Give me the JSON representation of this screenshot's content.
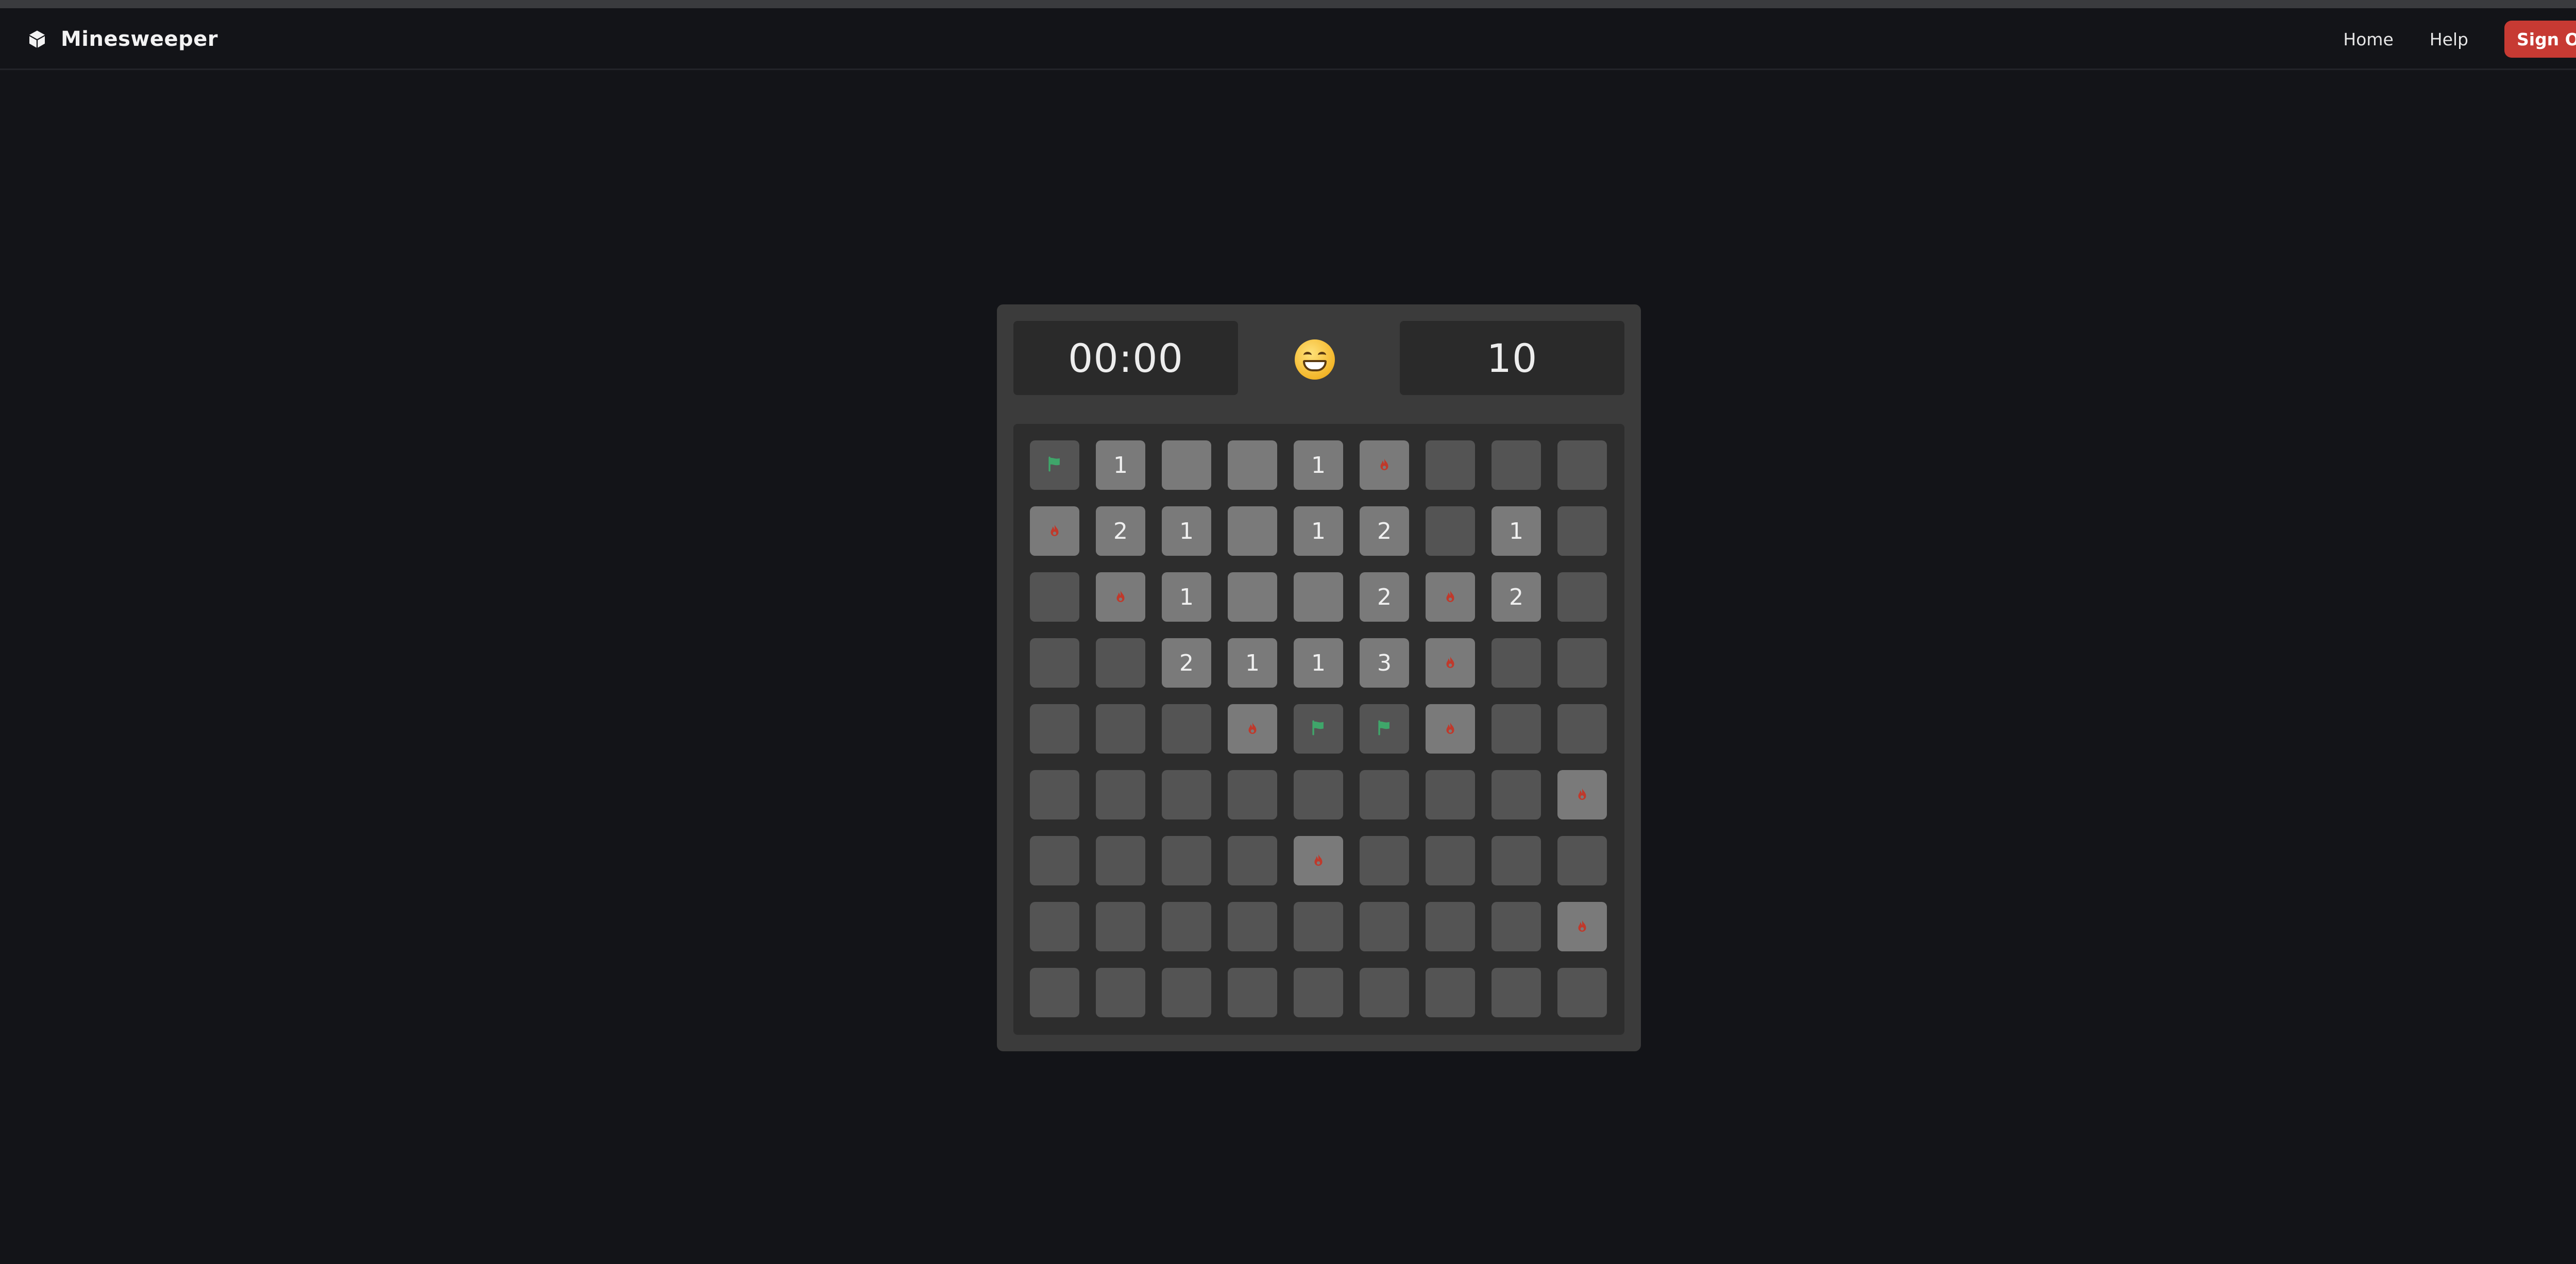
{
  "app": {
    "title": "Minesweeper",
    "brand_icon": "cube-icon"
  },
  "nav": {
    "home_label": "Home",
    "help_label": "Help",
    "signout_label": "Sign Out",
    "signout_color": "#c73a33"
  },
  "game": {
    "timer": "00:00",
    "mines_remaining": "10",
    "face_icon": "grinning-face-icon",
    "board": {
      "rows": 9,
      "cols": 9,
      "cells": [
        [
          "flag",
          "1",
          "empty",
          "empty",
          "1",
          "mine",
          "hidden",
          "hidden",
          "hidden"
        ],
        [
          "mine",
          "2",
          "1",
          "empty",
          "1",
          "2",
          "hidden",
          "1",
          "hidden"
        ],
        [
          "hidden",
          "mine",
          "1",
          "empty",
          "empty",
          "2",
          "mine",
          "2",
          "hidden"
        ],
        [
          "hidden",
          "hidden",
          "2",
          "1",
          "1",
          "3",
          "mine",
          "hidden",
          "hidden"
        ],
        [
          "hidden",
          "hidden",
          "hidden",
          "mine",
          "flag",
          "flag",
          "mine",
          "hidden",
          "hidden"
        ],
        [
          "hidden",
          "hidden",
          "hidden",
          "hidden",
          "hidden",
          "hidden",
          "hidden",
          "hidden",
          "mine"
        ],
        [
          "hidden",
          "hidden",
          "hidden",
          "hidden",
          "mine",
          "hidden",
          "hidden",
          "hidden",
          "hidden"
        ],
        [
          "hidden",
          "hidden",
          "hidden",
          "hidden",
          "hidden",
          "hidden",
          "hidden",
          "hidden",
          "mine"
        ],
        [
          "hidden",
          "hidden",
          "hidden",
          "hidden",
          "hidden",
          "hidden",
          "hidden",
          "hidden",
          "hidden"
        ]
      ]
    },
    "colors": {
      "hidden": "#545454",
      "revealed": "#7a7a7a",
      "flag": "#3fa66a",
      "mine": "#c0392b"
    }
  }
}
